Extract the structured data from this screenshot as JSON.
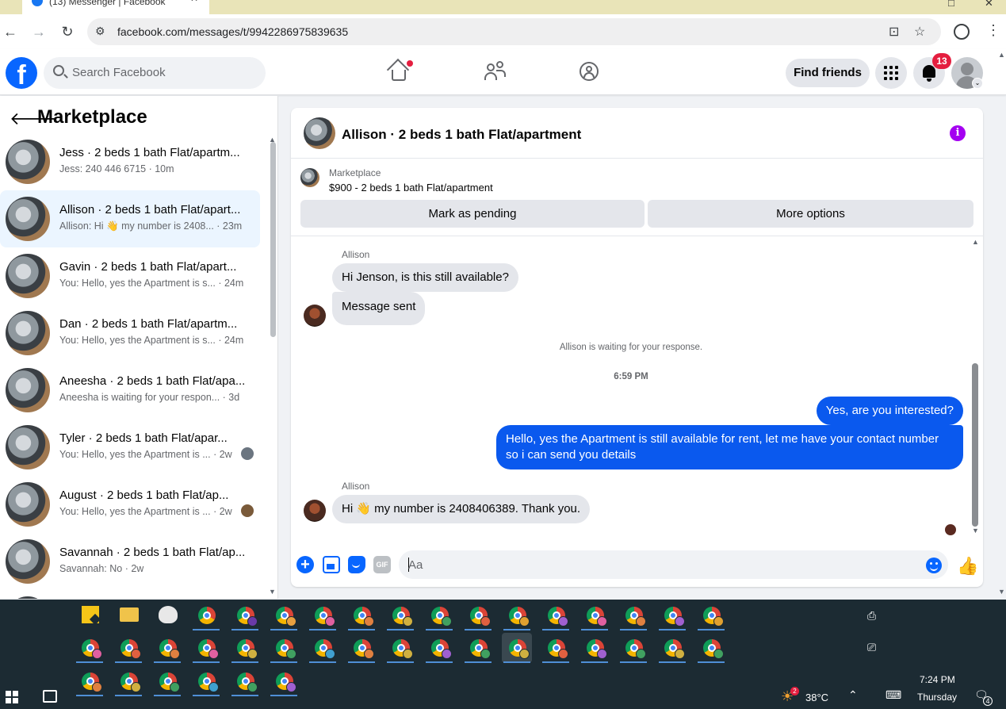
{
  "browser": {
    "tab_title": "(13) Messenger | Facebook",
    "url": "facebook.com/messages/t/9942286975839635"
  },
  "fb": {
    "logo": "f",
    "search_placeholder": "Search Facebook",
    "find_friends": "Find friends",
    "notif_count": "13"
  },
  "marketplace": {
    "title": "Marketplace",
    "conversations": [
      {
        "name": "Jess · 2 beds 1 bath Flat/apartm...",
        "preview": "Jess: 240 446 6715 · 10m"
      },
      {
        "name": "Allison · 2 beds 1 bath Flat/apart...",
        "preview": "Allison: Hi 👋 my number is 2408... · 23m"
      },
      {
        "name": "Gavin · 2 beds 1 bath Flat/apart...",
        "preview": "You: Hello, yes the Apartment is s... · 24m"
      },
      {
        "name": "Dan · 2 beds 1 bath Flat/apartm...",
        "preview": "You: Hello, yes the Apartment is s... · 24m"
      },
      {
        "name": "Aneesha · 2 beds 1 bath Flat/apa...",
        "preview": "Aneesha is waiting for your respon... · 3d"
      },
      {
        "name": "Tyler · 2 beds 1 bath Flat/apar...",
        "preview": "You: Hello, yes the Apartment is ... · 2w"
      },
      {
        "name": "August · 2 beds 1 bath Flat/ap...",
        "preview": "You: Hello, yes the Apartment is ... · 2w"
      },
      {
        "name": "Savannah · 2 beds 1 bath Flat/ap...",
        "preview": "Savannah: No · 2w"
      }
    ]
  },
  "chat": {
    "title": "Allison · 2 beds 1 bath Flat/apartment",
    "listing_source": "Marketplace",
    "listing_price": "$900 - 2 beds 1 bath Flat/apartment",
    "mark_pending": "Mark as pending",
    "more_options": "More options",
    "sender1": "Allison",
    "msg1": "Hi Jenson, is this still available?",
    "msg2": "Message sent",
    "system": "Allison is waiting for your response.",
    "time": "6:59 PM",
    "out1": "Yes, are you interested?",
    "out2": "Hello, yes the Apartment is still available for rent, let me have your contact number so i can send you details",
    "sender2": "Allison",
    "msg3": "Hi 👋  my number is 2408406389. Thank you.",
    "composer_placeholder": "Aa",
    "gif_label": "GIF"
  },
  "taskbar": {
    "weather": "38°C",
    "time": "7:24 PM",
    "day": "Thursday",
    "notif_count": "4",
    "weather_badge": "2"
  }
}
